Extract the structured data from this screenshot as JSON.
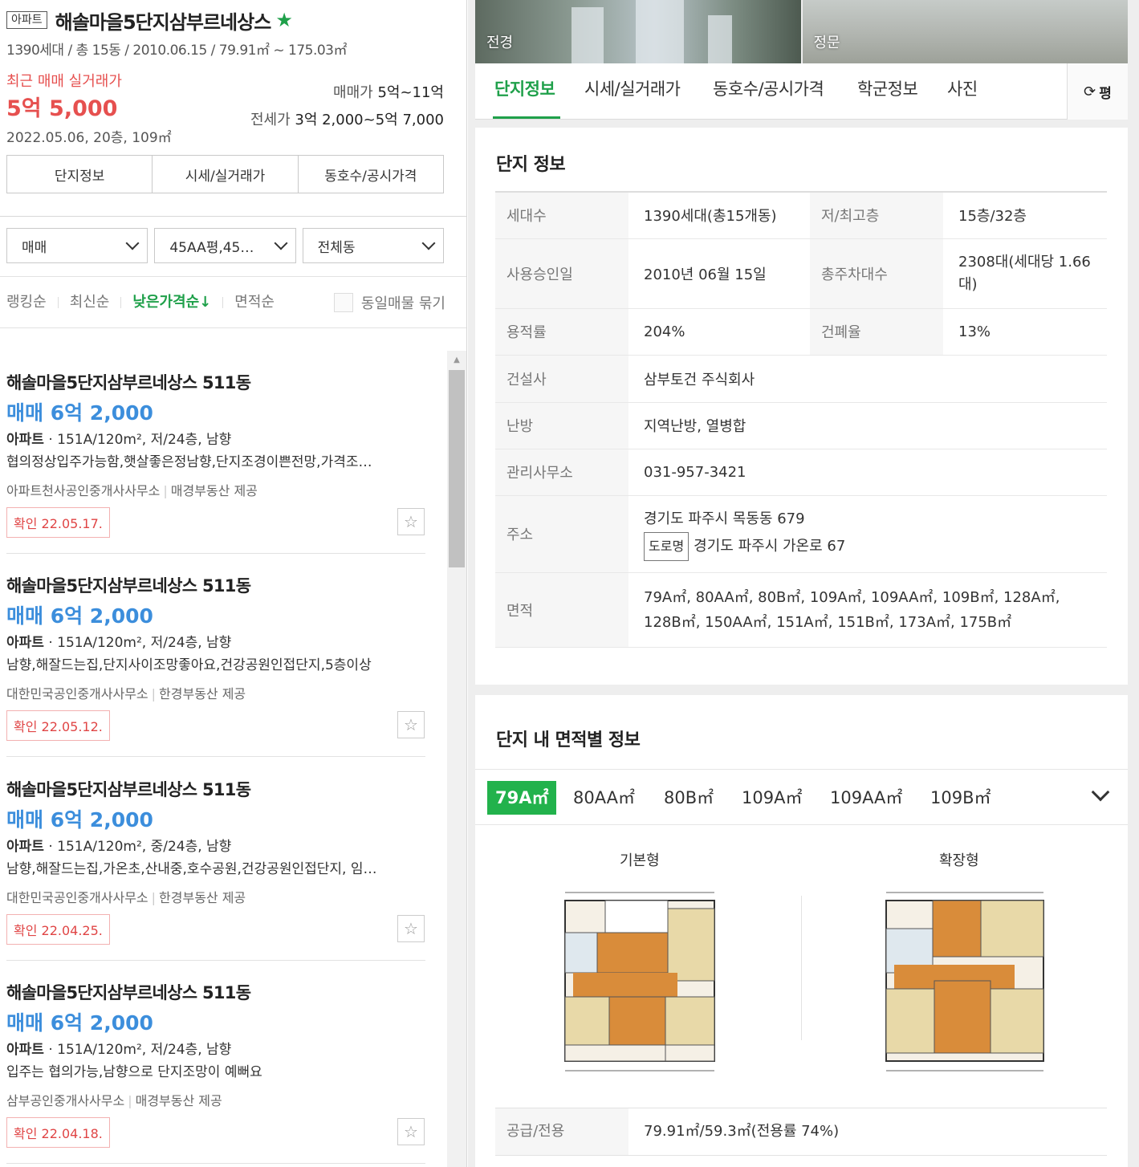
{
  "complex": {
    "type_badge": "아파트",
    "name": "해솔마을5단지삼부르네상스",
    "summary": "1390세대 / 총 15동 / 2010.06.15 / 79.91㎡ ~ 175.03㎡",
    "recent_label": "최근 매매 실거래가",
    "recent_price": "5억 5,000",
    "recent_date": "2022.05.06, 20층, 109㎡",
    "sale_range_label": "매매가",
    "sale_range": "5억~11억",
    "jeonse_range_label": "전세가",
    "jeonse_range": "3억 2,000~5억 7,000"
  },
  "left_tabs": [
    "단지정보",
    "시세/실거래가",
    "동호수/공시가격"
  ],
  "filters": [
    "매매",
    "45AA평,45…",
    "전체동"
  ],
  "sort": [
    "랭킹순",
    "최신순",
    "낮은가격순↓",
    "면적순"
  ],
  "group_label": "동일매물 묶기",
  "listings": [
    {
      "title": "해솔마을5단지삼부르네상스 511동",
      "price": "매매 6억 2,000",
      "type": "아파트",
      "spec": "151A/120m², 저/24층, 남향",
      "desc": "협의정상입주가능함,햇살좋은정남향,단지조경이쁜전망,가격조…",
      "agent": "아파트천사공인중개사사무소",
      "provider": "매경부동산 제공",
      "confirm": "확인 22.05.17."
    },
    {
      "title": "해솔마을5단지삼부르네상스 511동",
      "price": "매매 6억 2,000",
      "type": "아파트",
      "spec": "151A/120m², 저/24층, 남향",
      "desc": "남향,해잘드는집,단지사이조망좋아요,건강공원인접단지,5층이상",
      "agent": "대한민국공인중개사사무소",
      "provider": "한경부동산 제공",
      "confirm": "확인 22.05.12."
    },
    {
      "title": "해솔마을5단지삼부르네상스 511동",
      "price": "매매 6억 2,000",
      "type": "아파트",
      "spec": "151A/120m², 중/24층, 남향",
      "desc": "남향,해잘드는집,가온초,산내중,호수공원,건강공원인접단지, 임…",
      "agent": "대한민국공인중개사사무소",
      "provider": "한경부동산 제공",
      "confirm": "확인 22.04.25."
    },
    {
      "title": "해솔마을5단지삼부르네상스 511동",
      "price": "매매 6억 2,000",
      "type": "아파트",
      "spec": "151A/120m², 저/24층, 남향",
      "desc": "입주는 협의가능,남향으로 단지조망이 예뻐요",
      "agent": "삼부공인중개사사무소",
      "provider": "매경부동산 제공",
      "confirm": "확인 22.04.18."
    }
  ],
  "photos": [
    "전경",
    "정문"
  ],
  "right_tabs": [
    "단지정보",
    "시세/실거래가",
    "동호수/공시가격",
    "학군정보",
    "사진"
  ],
  "unit_toggle": "평",
  "info_title": "단지 정보",
  "info": {
    "households_k": "세대수",
    "households_v": "1390세대(총15개동)",
    "floors_k": "저/최고층",
    "floors_v": "15층/32층",
    "approval_k": "사용승인일",
    "approval_v": "2010년 06월 15일",
    "parking_k": "총주차대수",
    "parking_v": "2308대(세대당 1.66대)",
    "far_k": "용적률",
    "far_v": "204%",
    "bcr_k": "건폐율",
    "bcr_v": "13%",
    "builder_k": "건설사",
    "builder_v": "삼부토건 주식회사",
    "heating_k": "난방",
    "heating_v": "지역난방, 열병합",
    "office_k": "관리사무소",
    "office_v": "031-957-3421",
    "address_k": "주소",
    "address_v": "경기도 파주시 목동동 679",
    "road_badge": "도로명",
    "road_v": "경기도 파주시 가온로 67",
    "area_k": "면적",
    "area_v": "79A㎡, 80AA㎡, 80B㎡, 109A㎡, 109AA㎡, 109B㎡, 128A㎡, 128B㎡, 150AA㎡, 151A㎡, 151B㎡, 173A㎡, 175B㎡"
  },
  "area_section_title": "단지 내 면적별 정보",
  "area_tabs": [
    "79A㎡",
    "80AA㎡",
    "80B㎡",
    "109A㎡",
    "109AA㎡",
    "109B㎡"
  ],
  "plans": [
    "기본형",
    "확장형"
  ],
  "supply_k": "공급/전용",
  "supply_v": "79.91㎡/59.3㎡(전용률 74%)",
  "colors": {
    "accent_green": "#1fa04a",
    "price_red": "#e6504f",
    "price_blue": "#3c8edc"
  }
}
